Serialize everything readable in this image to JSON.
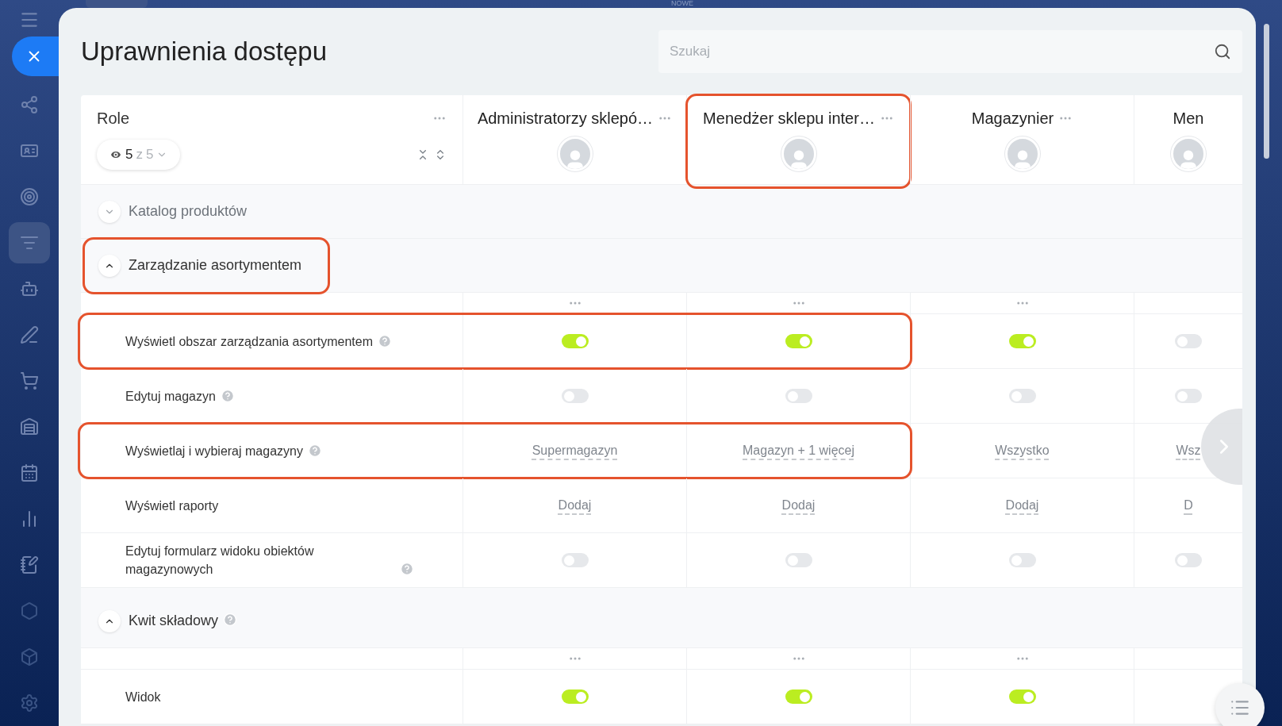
{
  "top_label": "NOWE",
  "title": "Uprawnienia dostępu",
  "search": {
    "placeholder": "Szukaj"
  },
  "roles_header": {
    "label": "Role",
    "filter": {
      "shown": "5",
      "separator": "z",
      "total": "5"
    }
  },
  "role_columns": [
    {
      "name": "Administratorzy sklepó…",
      "menu": true,
      "highlighted": false
    },
    {
      "name": "Menedżer sklepu inter…",
      "menu": true,
      "highlighted": true
    },
    {
      "name": "Magazynier",
      "menu": true,
      "highlighted": false
    },
    {
      "name": "Men",
      "menu": false,
      "highlighted": false
    }
  ],
  "sections": [
    {
      "title": "Katalog produktów",
      "expanded": false,
      "help": false,
      "highlighted": false
    },
    {
      "title": "Zarządzanie asortymentem",
      "expanded": true,
      "help": false,
      "highlighted": true,
      "rows": [
        {
          "label": "Wyświetl obszar zarządzania asortymentem",
          "help": true,
          "highlighted": true,
          "cells": [
            {
              "kind": "toggle",
              "on": true
            },
            {
              "kind": "toggle",
              "on": true
            },
            {
              "kind": "toggle",
              "on": true
            },
            {
              "kind": "toggle",
              "on": false
            }
          ]
        },
        {
          "label": "Edytuj magazyn",
          "help": true,
          "highlighted": false,
          "cells": [
            {
              "kind": "toggle",
              "on": false
            },
            {
              "kind": "toggle",
              "on": false
            },
            {
              "kind": "toggle",
              "on": false
            },
            {
              "kind": "toggle",
              "on": false
            }
          ]
        },
        {
          "label": "Wyświetlaj i wybieraj magazyny",
          "help": true,
          "highlighted": true,
          "cells": [
            {
              "kind": "link",
              "text": "Supermagazyn"
            },
            {
              "kind": "link",
              "text": "Magazyn + 1 więcej"
            },
            {
              "kind": "link",
              "text": "Wszystko"
            },
            {
              "kind": "link",
              "text": "Wsz"
            }
          ]
        },
        {
          "label": "Wyświetl raporty",
          "help": false,
          "highlighted": false,
          "cells": [
            {
              "kind": "link",
              "text": "Dodaj"
            },
            {
              "kind": "link",
              "text": "Dodaj"
            },
            {
              "kind": "link",
              "text": "Dodaj"
            },
            {
              "kind": "link",
              "text": "D"
            }
          ]
        },
        {
          "label": "Edytuj formularz widoku obiektów magazynowych",
          "help": true,
          "highlighted": false,
          "cells": [
            {
              "kind": "toggle",
              "on": false
            },
            {
              "kind": "toggle",
              "on": false
            },
            {
              "kind": "toggle",
              "on": false
            },
            {
              "kind": "toggle",
              "on": false
            }
          ]
        }
      ]
    },
    {
      "title": "Kwit składowy",
      "expanded": true,
      "help": true,
      "highlighted": false,
      "rows": [
        {
          "label": "Widok",
          "help": false,
          "highlighted": false,
          "cells": [
            {
              "kind": "toggle",
              "on": true
            },
            {
              "kind": "toggle",
              "on": true
            },
            {
              "kind": "toggle",
              "on": true
            }
          ]
        }
      ]
    }
  ]
}
